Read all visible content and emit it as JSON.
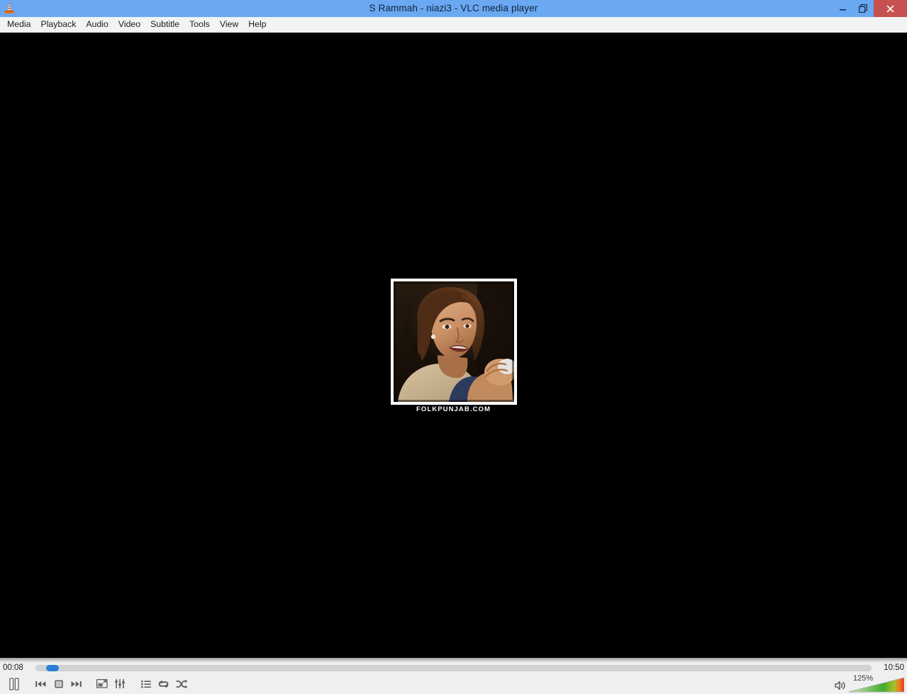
{
  "window": {
    "title": "S Rammah - niazi3 - VLC media player",
    "app_icon": "vlc-cone-icon",
    "titlebar_color": "#6aa8f2",
    "close_button_color": "#c75050",
    "buttons": {
      "minimize": "minimize",
      "restore": "restore",
      "close": "close"
    }
  },
  "menubar": {
    "items": [
      {
        "label": "Media"
      },
      {
        "label": "Playback"
      },
      {
        "label": "Audio"
      },
      {
        "label": "Video"
      },
      {
        "label": "Subtitle"
      },
      {
        "label": "Tools"
      },
      {
        "label": "View"
      },
      {
        "label": "Help"
      }
    ]
  },
  "video": {
    "background_color": "#000000",
    "artwork_caption": "FOLKPUNJAB.COM",
    "artwork_alt": "portrait-photo-of-woman-speaking"
  },
  "playback": {
    "elapsed_time": "00:08",
    "total_time": "10:50",
    "seek_percent": 1.2,
    "seek_handle_color": "#2a7fd4",
    "state": "playing"
  },
  "controls": {
    "play_pause": {
      "label": "Pause",
      "icon": "pause-icon"
    },
    "previous": {
      "label": "Previous",
      "icon": "previous-icon"
    },
    "stop": {
      "label": "Stop",
      "icon": "stop-icon"
    },
    "next": {
      "label": "Next",
      "icon": "next-icon"
    },
    "fullscreen": {
      "label": "Toggle fullscreen",
      "icon": "fullscreen-icon"
    },
    "extended_settings": {
      "label": "Show extended settings",
      "icon": "equalizer-icon"
    },
    "playlist": {
      "label": "Show playlist",
      "icon": "playlist-icon"
    },
    "loop": {
      "label": "Loop",
      "icon": "loop-icon"
    },
    "shuffle": {
      "label": "Random",
      "icon": "shuffle-icon"
    }
  },
  "volume": {
    "level_text": "125%",
    "level_value": 125,
    "mute_button": {
      "label": "Mute",
      "icon": "speaker-icon"
    },
    "gradient_start": "#c9e6b8",
    "gradient_mid": "#3faa2e",
    "gradient_end": "#e8471f"
  }
}
